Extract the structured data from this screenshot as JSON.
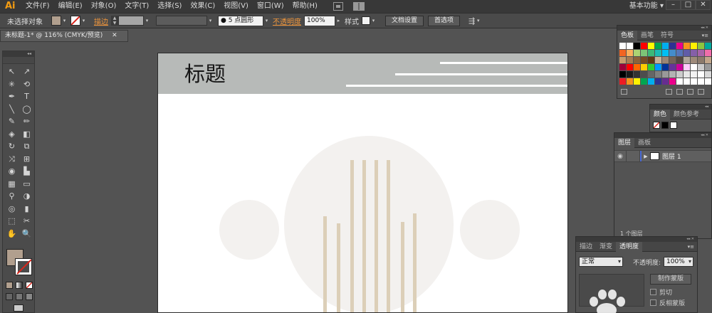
{
  "app": {
    "logo": "Ai",
    "workspace": "基本功能 ▾",
    "window_controls": [
      "–",
      "□",
      "✕"
    ]
  },
  "menu": [
    "文件(F)",
    "编辑(E)",
    "对象(O)",
    "文字(T)",
    "选择(S)",
    "效果(C)",
    "视图(V)",
    "窗口(W)",
    "帮助(H)"
  ],
  "control_bar": {
    "selection_label": "未选择对象",
    "fill_color": "#b19f8e",
    "stroke_label": "描边",
    "brush": "● 5 点圆形",
    "opacity_label": "不透明度",
    "opacity_value": "100%",
    "style_label": "样式",
    "doc_setup": "文档设置",
    "preferences": "首选项"
  },
  "document": {
    "tab_title": "未标题-1* @ 116% (CMYK/预览)",
    "close": "✕"
  },
  "tools": [
    [
      "↖",
      "↗"
    ],
    [
      "✳",
      "⟲"
    ],
    [
      "✒",
      "T"
    ],
    [
      "╲",
      "◯"
    ],
    [
      "✎",
      "✏"
    ],
    [
      "◈",
      "◧"
    ],
    [
      "↻",
      "⧉"
    ],
    [
      "⤨",
      "⊞"
    ],
    [
      "◉",
      "▙"
    ],
    [
      "▦",
      "▭"
    ],
    [
      "⚲",
      "◑"
    ],
    [
      "◎",
      "▮"
    ],
    [
      "⬚",
      "✂"
    ],
    [
      "✋",
      "🔍"
    ]
  ],
  "tools_panel": {
    "collapse": "◂◂",
    "fill": "#b19f8e",
    "stroke": "#ffffff"
  },
  "artboard": {
    "title": "标题",
    "header_color": "#b7bab8",
    "circle_color": "#f3f1ef",
    "bar_color": "#dccfb8"
  },
  "swatches_panel": {
    "tabs": [
      "色板",
      "画笔",
      "符号"
    ],
    "colors": [
      "#ffffff",
      "#ffffff",
      "#000000",
      "#ff0000",
      "#ffff00",
      "#00a651",
      "#00aeef",
      "#2e3192",
      "#ec008c",
      "#f7941d",
      "#fff200",
      "#8dc63f",
      "#00a99d",
      "#0072bc",
      "#f26522",
      "#fbaf5d",
      "#acd373",
      "#7cc576",
      "#3cb878",
      "#1cbbb4",
      "#00bff3",
      "#448ccb",
      "#5674b9",
      "#605ca8",
      "#855fa8",
      "#a864a8",
      "#f06eaa",
      "#f26d7d",
      "#c69c6d",
      "#a67c52",
      "#8c6239",
      "#754c24",
      "#603913",
      "#c7b299",
      "#998675",
      "#736357",
      "#534741",
      "#b0a69c",
      "#9e8a7a",
      "#8c7a6b",
      "#c2a68a",
      "#e8d3b9",
      "#9e0039",
      "#ff0000",
      "#ff6600",
      "#ffcc00",
      "#33cc33",
      "#0099ff",
      "#003399",
      "#663399",
      "#cc0099",
      "#ffccff",
      "#ffffff",
      "#cccccc",
      "#999999",
      "#666666",
      "#000000",
      "#1a1a1a",
      "#333333",
      "#4d4d4d",
      "#666666",
      "#808080",
      "#999999",
      "#b3b3b3",
      "#cccccc",
      "#e6e6e6",
      "#f2f2f2",
      "#ffffff",
      "#d9d9d9",
      "#bfbfbf",
      "#ed1c24",
      "#f7941d",
      "#fff200",
      "#00a651",
      "#00aeef",
      "#2e3192",
      "#662d91",
      "#ec008c",
      "#ffffff",
      "#ffffff",
      "#ffffff",
      "#ffffff",
      "#ffffff",
      "#ffffff"
    ]
  },
  "color_panel": {
    "tabs": [
      "颜色",
      "颜色参考"
    ]
  },
  "layers_panel": {
    "tabs": [
      "图层",
      "画板"
    ],
    "layer_name": "图层 1",
    "footer": "1 个图层"
  },
  "transparency_panel": {
    "tabs": [
      "描边",
      "渐变",
      "透明度"
    ],
    "blend_mode": "正常",
    "opacity_label": "不透明度:",
    "opacity_value": "100%",
    "make_mask": "制作蒙版",
    "clip": "剪切",
    "invert": "反相蒙版"
  }
}
